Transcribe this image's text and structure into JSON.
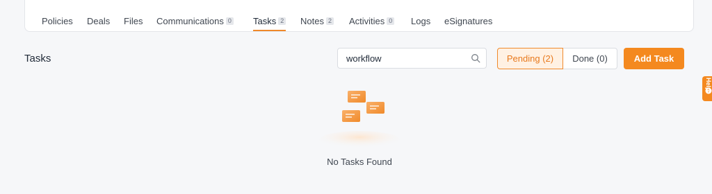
{
  "tabs": [
    {
      "label": "Policies",
      "badge": null,
      "active": false
    },
    {
      "label": "Deals",
      "badge": null,
      "active": false
    },
    {
      "label": "Files",
      "badge": null,
      "active": false
    },
    {
      "label": "Communications",
      "badge": "0",
      "active": false
    },
    {
      "label": "Tasks",
      "badge": "2",
      "active": true
    },
    {
      "label": "Notes",
      "badge": "2",
      "active": false
    },
    {
      "label": "Activities",
      "badge": "0",
      "active": false
    },
    {
      "label": "Logs",
      "badge": null,
      "active": false
    },
    {
      "label": "eSignatures",
      "badge": null,
      "active": false
    }
  ],
  "section": {
    "title": "Tasks"
  },
  "search": {
    "value": "workflow",
    "icon": "search-icon"
  },
  "filters": {
    "pending_label": "Pending (2)",
    "done_label": "Done (0)"
  },
  "actions": {
    "add_task_label": "Add Task"
  },
  "help": {
    "label": "Help",
    "icon": "help-circle-icon"
  },
  "empty_state": {
    "message": "No Tasks Found"
  },
  "colors": {
    "accent": "#f4891f",
    "accent_light": "#fff1e3",
    "background": "#f6f7f9"
  }
}
